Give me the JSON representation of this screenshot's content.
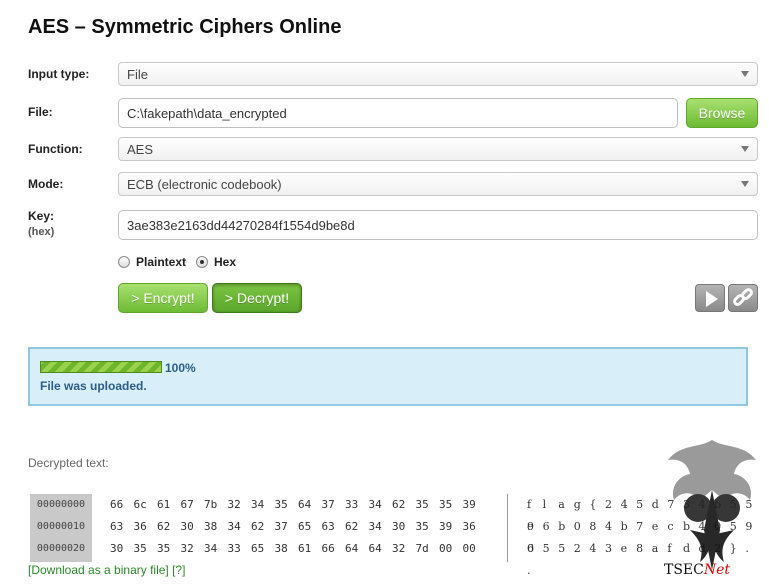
{
  "page": {
    "title": "AES – Symmetric Ciphers Online"
  },
  "form": {
    "input_type": {
      "label": "Input type:",
      "value": "File"
    },
    "file": {
      "label": "File:",
      "value": "C:\\fakepath\\data_encrypted",
      "browse_label": "Browse"
    },
    "function": {
      "label": "Function:",
      "value": "AES"
    },
    "mode": {
      "label": "Mode:",
      "value": "ECB (electronic codebook)"
    },
    "key": {
      "label": "Key:",
      "sublabel": "(hex)",
      "value": "3ae383e2163dd44270284f1554d9be8d"
    },
    "key_format": {
      "options": [
        "Plaintext",
        "Hex"
      ],
      "selected": "Hex"
    },
    "encrypt_label": "> Encrypt!",
    "decrypt_label": "> Decrypt!"
  },
  "upload": {
    "progress": 100,
    "percent_label": "100%",
    "status": "File was uploaded."
  },
  "output": {
    "label": "Decrypted text:",
    "rows": [
      {
        "offset": "00000000",
        "hex": [
          "66",
          "6c",
          "61",
          "67",
          "7b",
          "32",
          "34",
          "35",
          "64",
          "37",
          "33",
          "34",
          "62",
          "35",
          "35",
          "39"
        ],
        "ascii": [
          "f",
          "l",
          "a",
          "g",
          "{",
          "2",
          "4",
          "5",
          "d",
          "7",
          "3",
          "4",
          "b",
          "5",
          "5",
          "9"
        ]
      },
      {
        "offset": "00000010",
        "hex": [
          "63",
          "36",
          "62",
          "30",
          "38",
          "34",
          "62",
          "37",
          "65",
          "63",
          "62",
          "34",
          "30",
          "35",
          "39",
          "36"
        ],
        "ascii": [
          "c",
          "6",
          "b",
          "0",
          "8",
          "4",
          "b",
          "7",
          "e",
          "c",
          "b",
          "4",
          "0",
          "5",
          "9",
          "6"
        ]
      },
      {
        "offset": "00000020",
        "hex": [
          "30",
          "35",
          "35",
          "32",
          "34",
          "33",
          "65",
          "38",
          "61",
          "66",
          "64",
          "64",
          "32",
          "7d",
          "00",
          "00"
        ],
        "ascii": [
          "0",
          "5",
          "5",
          "2",
          "4",
          "3",
          "e",
          "8",
          "a",
          "f",
          "d",
          "d",
          "2",
          "}",
          ".",
          "."
        ]
      }
    ],
    "download_link": "[Download as a binary file]",
    "help_link": "[?]"
  },
  "watermark": {
    "prefix": "T",
    "middle": "SEC",
    "suffix": "Net"
  }
}
